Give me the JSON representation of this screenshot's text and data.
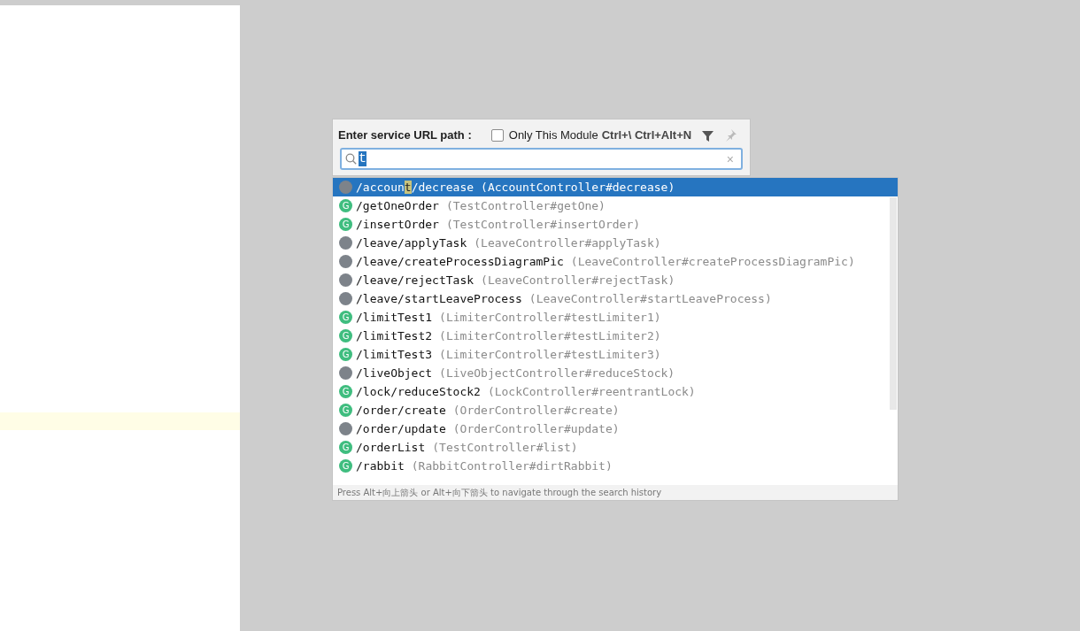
{
  "popup": {
    "title": "Enter service URL path :",
    "module_filter": {
      "label": "Only This Module",
      "shortcut": "Ctrl+\\ Ctrl+Alt+N",
      "checked": false
    },
    "search": {
      "value": "t",
      "clear": "×"
    }
  },
  "results": [
    {
      "kind": "other",
      "selected": true,
      "path": "/accoun",
      "match": "t",
      "path_after": "/decrease",
      "handler": "(AccountController#decrease)"
    },
    {
      "kind": "get",
      "badge": "G",
      "selected": false,
      "path": "/getOneOrder",
      "handler": "(TestController#getOne)"
    },
    {
      "kind": "get",
      "badge": "G",
      "selected": false,
      "path": "/insertOrder",
      "handler": "(TestController#insertOrder)"
    },
    {
      "kind": "other",
      "selected": false,
      "path": "/leave/applyTask",
      "handler": "(LeaveController#applyTask)"
    },
    {
      "kind": "other",
      "selected": false,
      "path": "/leave/createProcessDiagramPic",
      "handler": "(LeaveController#createProcessDiagramPic)"
    },
    {
      "kind": "other",
      "selected": false,
      "path": "/leave/rejectTask",
      "handler": "(LeaveController#rejectTask)"
    },
    {
      "kind": "other",
      "selected": false,
      "path": "/leave/startLeaveProcess",
      "handler": "(LeaveController#startLeaveProcess)"
    },
    {
      "kind": "get",
      "badge": "G",
      "selected": false,
      "path": "/limitTest1",
      "handler": "(LimiterController#testLimiter1)"
    },
    {
      "kind": "get",
      "badge": "G",
      "selected": false,
      "path": "/limitTest2",
      "handler": "(LimiterController#testLimiter2)"
    },
    {
      "kind": "get",
      "badge": "G",
      "selected": false,
      "path": "/limitTest3",
      "handler": "(LimiterController#testLimiter3)"
    },
    {
      "kind": "other",
      "selected": false,
      "path": "/liveObject",
      "handler": "(LiveObjectController#reduceStock)"
    },
    {
      "kind": "get",
      "badge": "G",
      "selected": false,
      "path": "/lock/reduceStock2",
      "handler": "(LockController#reentrantLock)"
    },
    {
      "kind": "get",
      "badge": "G",
      "selected": false,
      "path": "/order/create",
      "handler": "(OrderController#create)"
    },
    {
      "kind": "other",
      "selected": false,
      "path": "/order/update",
      "handler": "(OrderController#update)"
    },
    {
      "kind": "get",
      "badge": "G",
      "selected": false,
      "path": "/orderList",
      "handler": "(TestController#list)"
    },
    {
      "kind": "get",
      "badge": "G",
      "selected": false,
      "path": "/rabbit",
      "handler": "(RabbitController#dirtRabbit)"
    }
  ],
  "hint": "Press Alt+向上箭头 or Alt+向下箭头 to navigate through the search history"
}
